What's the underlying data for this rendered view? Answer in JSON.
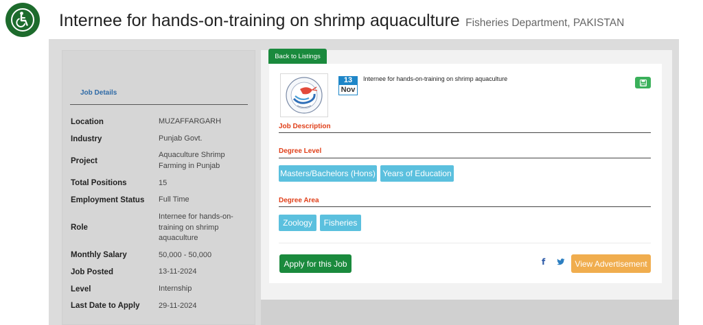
{
  "header": {
    "title": "Internee for hands-on-training on shrimp aquaculture",
    "department": "Fisheries Department, PAKISTAN"
  },
  "icons": {
    "accessibility": "wheelchair-icon",
    "save": "floppy-disk-icon",
    "facebook": "facebook-icon",
    "twitter": "twitter-icon"
  },
  "colors": {
    "accent_green": "#1a8a3d",
    "chip_blue": "#5bc0de",
    "section_red": "#e0401a",
    "advert_orange": "#f0ad4e",
    "date_blue": "#1e86c8"
  },
  "sidebar": {
    "title": "Job Details",
    "rows": [
      {
        "label": "Location",
        "value": "MUZAFFARGARH"
      },
      {
        "label": "Industry",
        "value": "Punjab Govt."
      },
      {
        "label": "Project",
        "value": "Aquaculture Shrimp Farming in Punjab"
      },
      {
        "label": "Total Positions",
        "value": "15"
      },
      {
        "label": "Employment Status",
        "value": "Full Time"
      },
      {
        "label": "Role",
        "value": "Internee for hands-on-training on shrimp aquaculture"
      },
      {
        "label": "Monthly Salary",
        "value": "50,000 - 50,000"
      },
      {
        "label": "Job Posted",
        "value": "13-11-2024"
      },
      {
        "label": "Level",
        "value": "Internship"
      },
      {
        "label": "Last Date to Apply",
        "value": "29-11-2024"
      }
    ]
  },
  "card": {
    "back_label": "Back to Listings",
    "date_day": "13",
    "date_month": "Nov",
    "job_title": "Internee for hands-on-training on shrimp aquaculture",
    "sections": {
      "description": "Job Description",
      "degree_level": "Degree Level",
      "degree_area": "Degree Area"
    },
    "degree_levels": [
      "Masters/Bachelors (Hons)",
      "Years of Education"
    ],
    "degree_areas": [
      "Zoology",
      "Fisheries"
    ],
    "apply_label": "Apply for this Job",
    "view_ad_label": "View Advertisement",
    "facebook_glyph": "f"
  }
}
